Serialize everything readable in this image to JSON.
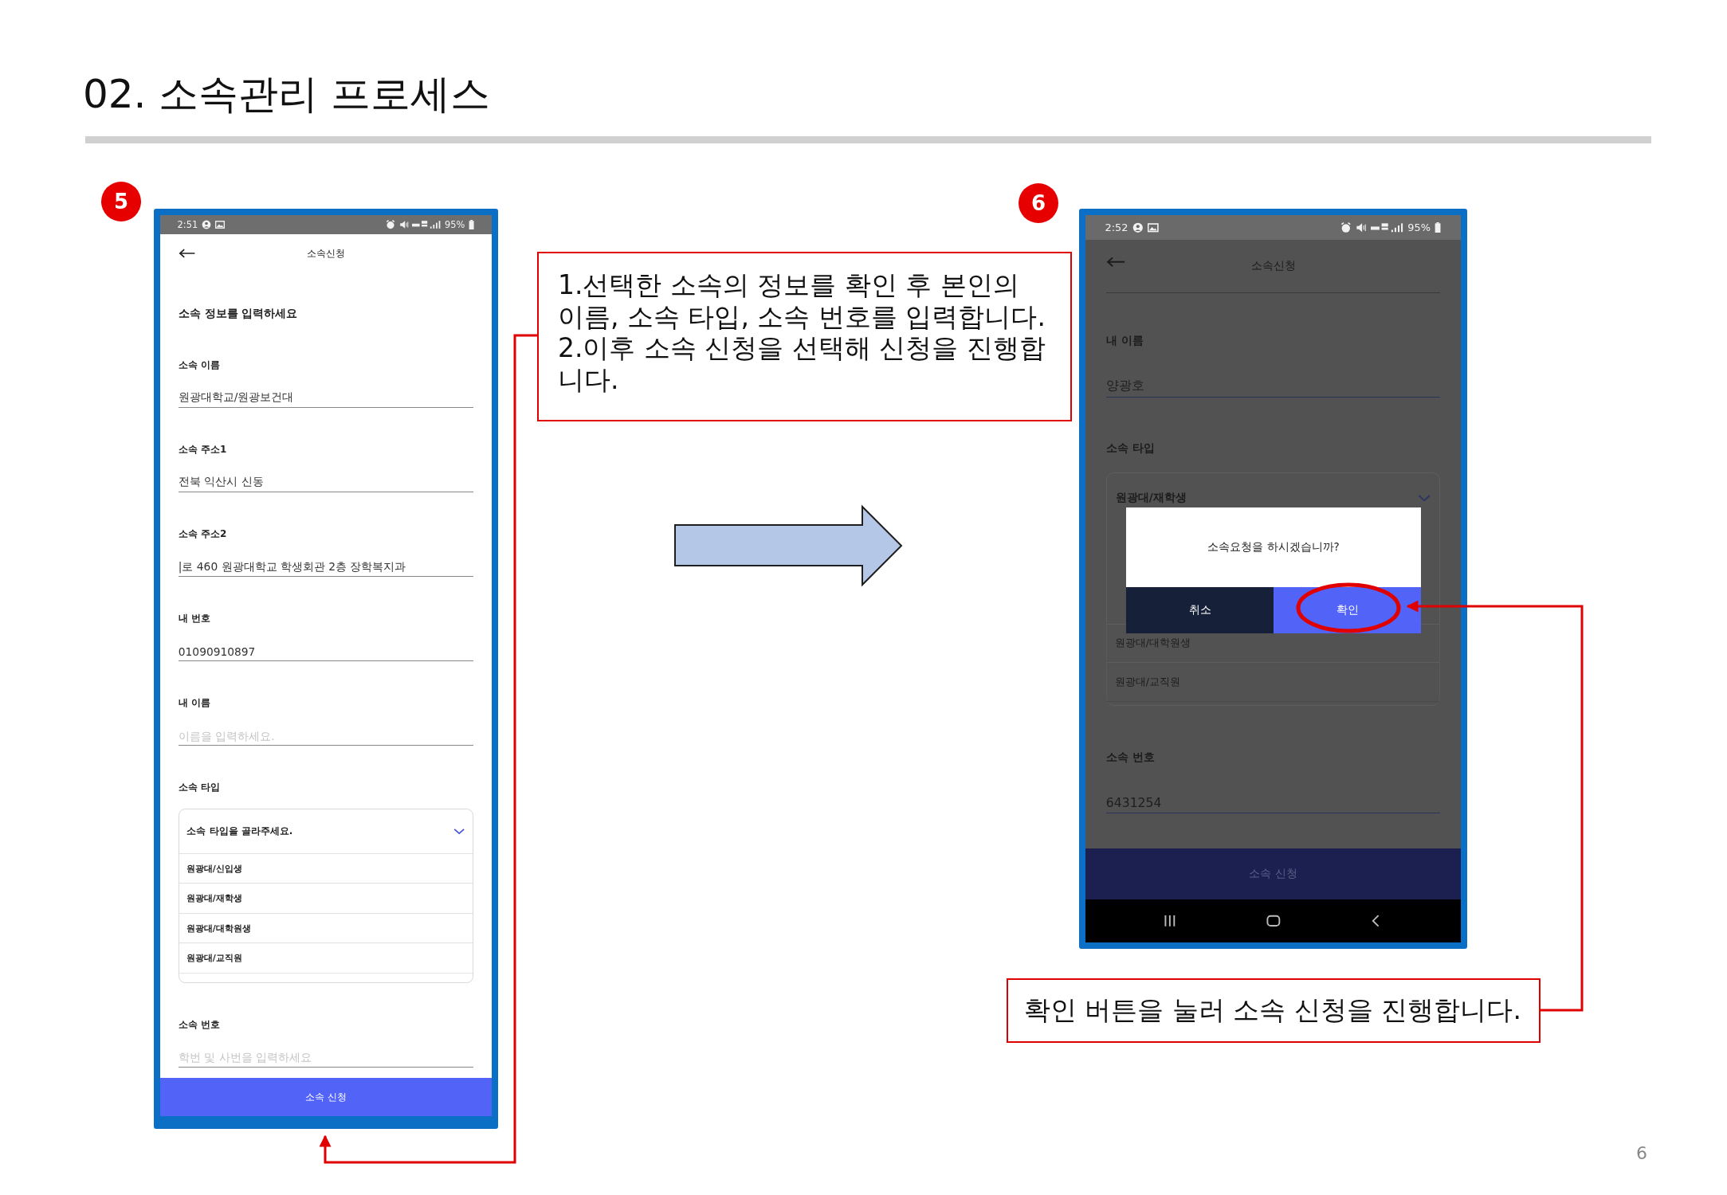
{
  "slide": {
    "title": "02. 소속관리 프로세스",
    "page_number": "6"
  },
  "steps": [
    {
      "badge": "5",
      "phone": {
        "dimmed": false,
        "status": {
          "time": "2:51",
          "battery": "95%"
        },
        "header": {
          "title": "소속신청"
        },
        "intro": "소속 정보를 입력하세요",
        "fields": [
          {
            "kind": "text",
            "label": "소속 이름",
            "value": "원광대학교/원광보건대"
          },
          {
            "kind": "text",
            "label": "소속 주소1",
            "value": "전북 익산시 신동"
          },
          {
            "kind": "text",
            "label": "소속 주소2",
            "value": "|로 460 원광대학교 학생회관 2층 장학복지과"
          },
          {
            "kind": "text",
            "label": "내 번호",
            "value": "01090910897"
          },
          {
            "kind": "text",
            "label": "내 이름",
            "placeholder": "이름을 입력하세요."
          },
          {
            "kind": "select",
            "label": "소속 타입",
            "prompt": "소속 타입을 골라주세요.",
            "expanded": true,
            "options": [
              "원광대/신입생",
              "원광대/재학생",
              "원광대/대학원생",
              "원광대/교직원"
            ]
          },
          {
            "kind": "text",
            "label": "소속 번호",
            "placeholder": "학번 및 사번을 입력하세요"
          }
        ],
        "submit": "소속 신청"
      }
    },
    {
      "badge": "6",
      "phone": {
        "dimmed": true,
        "nav_bar": {
          "kind": "buttons"
        },
        "status": {
          "time": "2:52",
          "battery": "95%"
        },
        "header": {
          "title": "소속신청"
        },
        "fields": [
          {
            "kind": "text",
            "label": "내 이름",
            "value": "양광호"
          },
          {
            "kind": "select",
            "label": "소속 타입",
            "value": "원광대/재학생",
            "expanded": true,
            "options": [
              "원광대/대학원생",
              "원광대/교직원"
            ]
          },
          {
            "kind": "text",
            "label": "소속 번호",
            "value": "6431254"
          }
        ],
        "submit": "소속 신청",
        "dialog": {
          "message": "소속요청을 하시겠습니까?",
          "buttons": [
            {
              "kind": "cancel",
              "label": "취소"
            },
            {
              "kind": "confirm",
              "label": "확인"
            }
          ]
        }
      }
    }
  ],
  "notes": [
    {
      "paragraphs": [
        "1.선택한 소속의 정보를 확인 후 본인의 이름, 소속 타입, 소속 번호를 입력합니다.",
        "2.이후 소속 신청을 선택해 신청을 진행합니다."
      ]
    },
    {
      "paragraphs": [
        "확인 버튼을 눌러 소속 신청을 진행합니다."
      ]
    }
  ]
}
